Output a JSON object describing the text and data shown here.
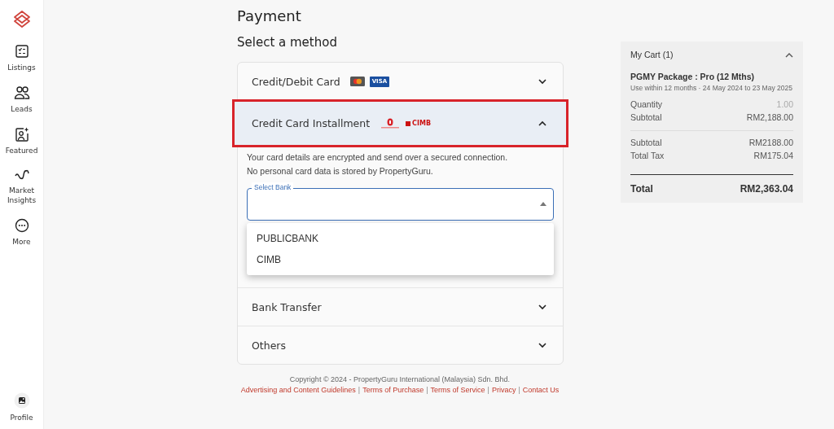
{
  "sidebar": {
    "items": [
      {
        "kind": "listings",
        "label": "Listings"
      },
      {
        "kind": "leads",
        "label": "Leads"
      },
      {
        "kind": "featured",
        "label": "Featured"
      },
      {
        "kind": "insights",
        "label": "Market Insights"
      },
      {
        "kind": "more",
        "label": "More"
      }
    ],
    "profile": {
      "label": "Profile"
    }
  },
  "page": {
    "title": "Payment",
    "subtitle": "Select a method"
  },
  "methods": [
    {
      "label": "Credit/Debit Card",
      "logos": [
        {
          "kind": "mastercard"
        },
        {
          "kind": "visa",
          "text": "VISA"
        }
      ],
      "expanded": false,
      "highlighted": false
    },
    {
      "label": "Credit Card Installment",
      "logos": [
        {
          "kind": "publicbank"
        },
        {
          "kind": "cimb",
          "text": "CIMB"
        }
      ],
      "expanded": true,
      "highlighted": true,
      "body": {
        "notes": [
          "Your card details are encrypted and send over a secured connection.",
          "No personal card data is stored by PropertyGuru."
        ],
        "select": {
          "label": "Select Bank",
          "open": true,
          "options": [
            "PUBLICBANK",
            "CIMB"
          ]
        }
      }
    },
    {
      "label": "Bank Transfer",
      "expanded": false,
      "highlighted": false
    },
    {
      "label": "Others",
      "expanded": false,
      "highlighted": false
    }
  ],
  "cart": {
    "title": "My Cart (1)",
    "expanded": true,
    "item": {
      "name": "PGMY Package : Pro (12 Mths)",
      "validity": "Use within 12 months · 24 May 2024 to 23 May 2025"
    },
    "item_rows": [
      {
        "label": "Quantity",
        "value": "1.00",
        "muted": true
      },
      {
        "label": "Subtotal",
        "value": "RM2,188.00",
        "muted": false
      }
    ],
    "summary_rows": [
      {
        "label": "Subtotal",
        "value": "RM2188.00"
      },
      {
        "label": "Total Tax",
        "value": "RM175.04"
      }
    ],
    "total": {
      "label": "Total",
      "value": "RM2,363.04"
    }
  },
  "footer": {
    "copyright": "Copyright © 2024 - PropertyGuru International (Malaysia) Sdn. Bhd.",
    "links": [
      "Advertising and Content Guidelines",
      "Terms of Purchase",
      "Terms of Service",
      "Privacy",
      "Contact Us"
    ],
    "separator": "|"
  }
}
